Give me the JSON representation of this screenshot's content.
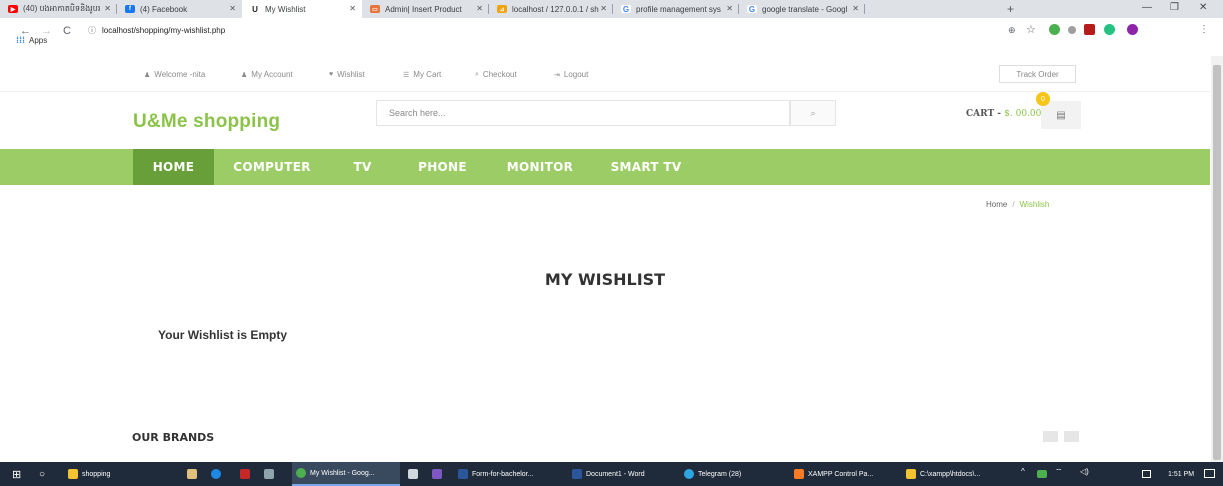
{
  "browser": {
    "tabs": [
      {
        "label": "(40) បងអាកាតបិទនិងរូបរ",
        "fav": "▶",
        "fav_color": "#ff0000"
      },
      {
        "label": "(4) Facebook",
        "fav": "f",
        "fav_color": "#1877f2"
      },
      {
        "label": "My Wishlist",
        "fav": "U",
        "fav_color": "#222222"
      },
      {
        "label": "Admin| Insert Product",
        "fav": "▭",
        "fav_color": "#e8743b"
      },
      {
        "label": "localhost / 127.0.0.1 / sh",
        "fav": "⊿",
        "fav_color": "#f0a30a"
      },
      {
        "label": "profile management sys",
        "fav": "G",
        "fav_color": "#4285f4"
      },
      {
        "label": "google translate - Googl",
        "fav": "G",
        "fav_color": "#4285f4"
      }
    ],
    "new_tab": "+",
    "window_controls": {
      "minimize": "—",
      "restore": "❐",
      "close": "✕"
    },
    "url_info_icon": "ⓘ",
    "url": "localhost/shopping/my-wishlist.php",
    "bookmarks_apps": "Apps",
    "nav_icons": {
      "back": "←",
      "forward": "→",
      "reload": "C"
    },
    "toolbar_icons": {
      "zoom": "⊕",
      "star": "☆"
    }
  },
  "site": {
    "top_links": [
      {
        "icon": "♟",
        "label": "Welcome -nita"
      },
      {
        "icon": "♟",
        "label": "My Account"
      },
      {
        "icon": "♥",
        "label": "Wishlist"
      },
      {
        "icon": "☰",
        "label": "My Cart"
      },
      {
        "icon": "⌕",
        "label": "Checkout"
      },
      {
        "icon": "⇥",
        "label": "Logout"
      }
    ],
    "track_order": "Track Order",
    "logo": "U&Me shopping",
    "search_placeholder": "Search here...",
    "search_icon": "⌕",
    "cart_label": "CART - ",
    "cart_total": "$. 00.00",
    "cart_count": "0",
    "cart_icon": "🛒",
    "nav": [
      "HOME",
      "COMPUTER",
      "TV",
      "PHONE",
      "MONITOR",
      "SMART TV"
    ],
    "breadcrumb": {
      "home": "Home",
      "sep": "/",
      "current": "Wishlish"
    },
    "page_title": "MY WISHLIST",
    "empty_message": "Your Wishlist is Empty",
    "brands_title": "OUR BRANDS"
  },
  "taskbar": {
    "items": [
      {
        "label": "shopping",
        "color": "#f4c430"
      },
      {
        "label": "My Wishlist - Goog...",
        "color": "#4caf50"
      },
      {
        "label": "Form-for-bachelor...",
        "color": "#2b579a"
      },
      {
        "label": "Document1 - Word",
        "color": "#2b579a"
      },
      {
        "label": "Telegram (28)",
        "color": "#2ca5e0"
      },
      {
        "label": "XAMPP Control Pa...",
        "color": "#fb7a24"
      },
      {
        "label": "C:\\xampp\\htdocs\\...",
        "color": "#f4c430"
      }
    ],
    "time": "1:51 PM",
    "tray": {
      "up": "^",
      "wifi": "⌔",
      "volume": "🔊"
    },
    "start_icon": "⊞",
    "search_icon": "○"
  }
}
